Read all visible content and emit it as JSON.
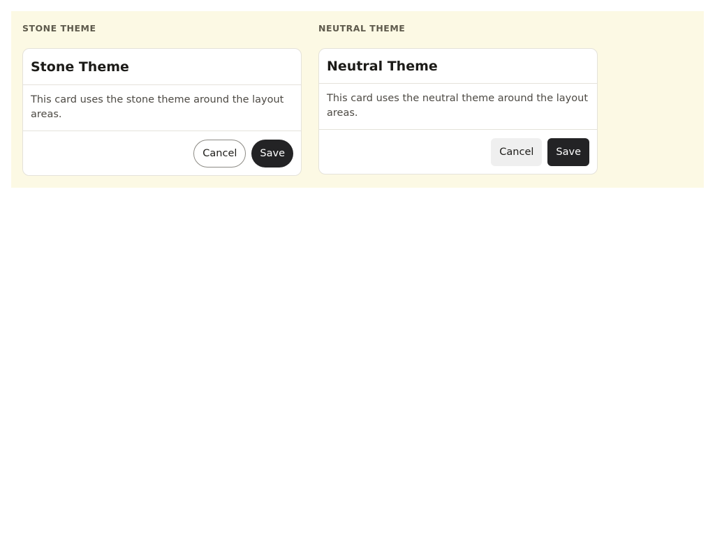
{
  "sections": [
    {
      "label": "STONE THEME",
      "card": {
        "title": "Stone Theme",
        "body": "This card uses the stone theme around the layout areas.",
        "cancel_label": "Cancel",
        "save_label": "Save"
      }
    },
    {
      "label": "NEUTRAL THEME",
      "card": {
        "title": "Neutral Theme",
        "body": "This card uses the neutral theme around the layout areas.",
        "cancel_label": "Cancel",
        "save_label": "Save"
      }
    }
  ],
  "colors": {
    "panel_background": "#fcf9e4",
    "primary_button": "#232325",
    "neutral_cancel_background": "#efefef",
    "section_label": "#5e5a4c"
  }
}
